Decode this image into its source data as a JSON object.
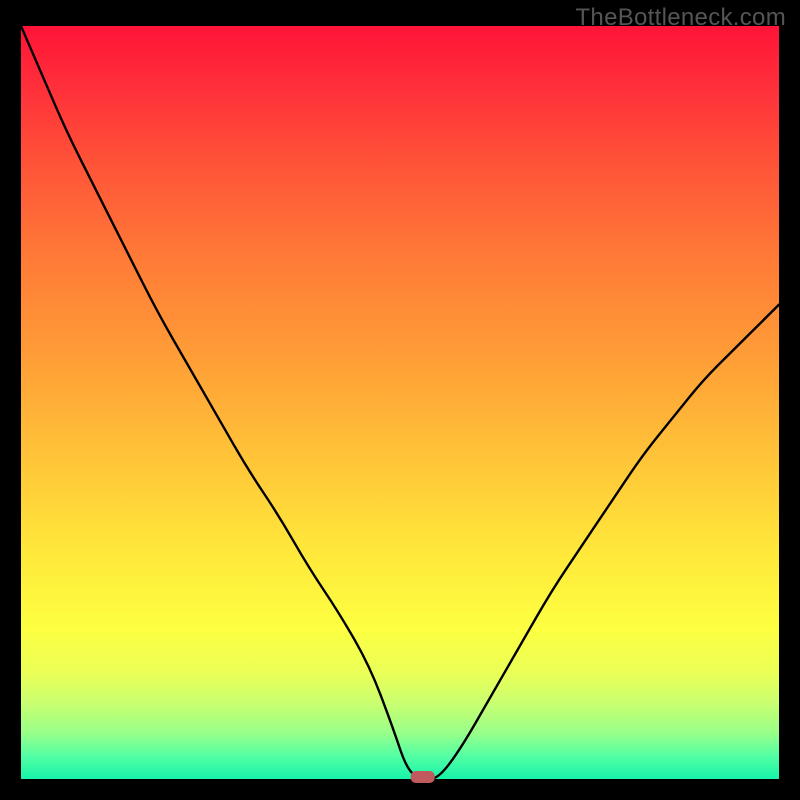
{
  "watermark": "TheBottleneck.com",
  "chart_data": {
    "type": "line",
    "title": "",
    "xlabel": "",
    "ylabel": "",
    "xlim": [
      0,
      100
    ],
    "ylim": [
      0,
      100
    ],
    "series": [
      {
        "name": "bottleneck-curve",
        "x": [
          0,
          3,
          6,
          10,
          14,
          18,
          22,
          26,
          30,
          34,
          38,
          42,
          46,
          49,
          51,
          53,
          55,
          58,
          62,
          66,
          70,
          74,
          78,
          82,
          86,
          90,
          94,
          98,
          100
        ],
        "values": [
          100,
          93,
          86,
          78,
          70,
          62,
          55,
          48,
          41,
          35,
          28,
          22,
          15,
          7,
          1,
          0,
          0,
          4,
          11,
          18,
          25,
          31,
          37,
          43,
          48,
          53,
          57,
          61,
          63
        ]
      }
    ],
    "marker": {
      "x": 53,
      "y": 0,
      "color": "#c05a5f",
      "shape": "rounded-rect"
    },
    "background_gradient": {
      "top": "#ff1337",
      "bottom": "#17f3a9"
    }
  }
}
